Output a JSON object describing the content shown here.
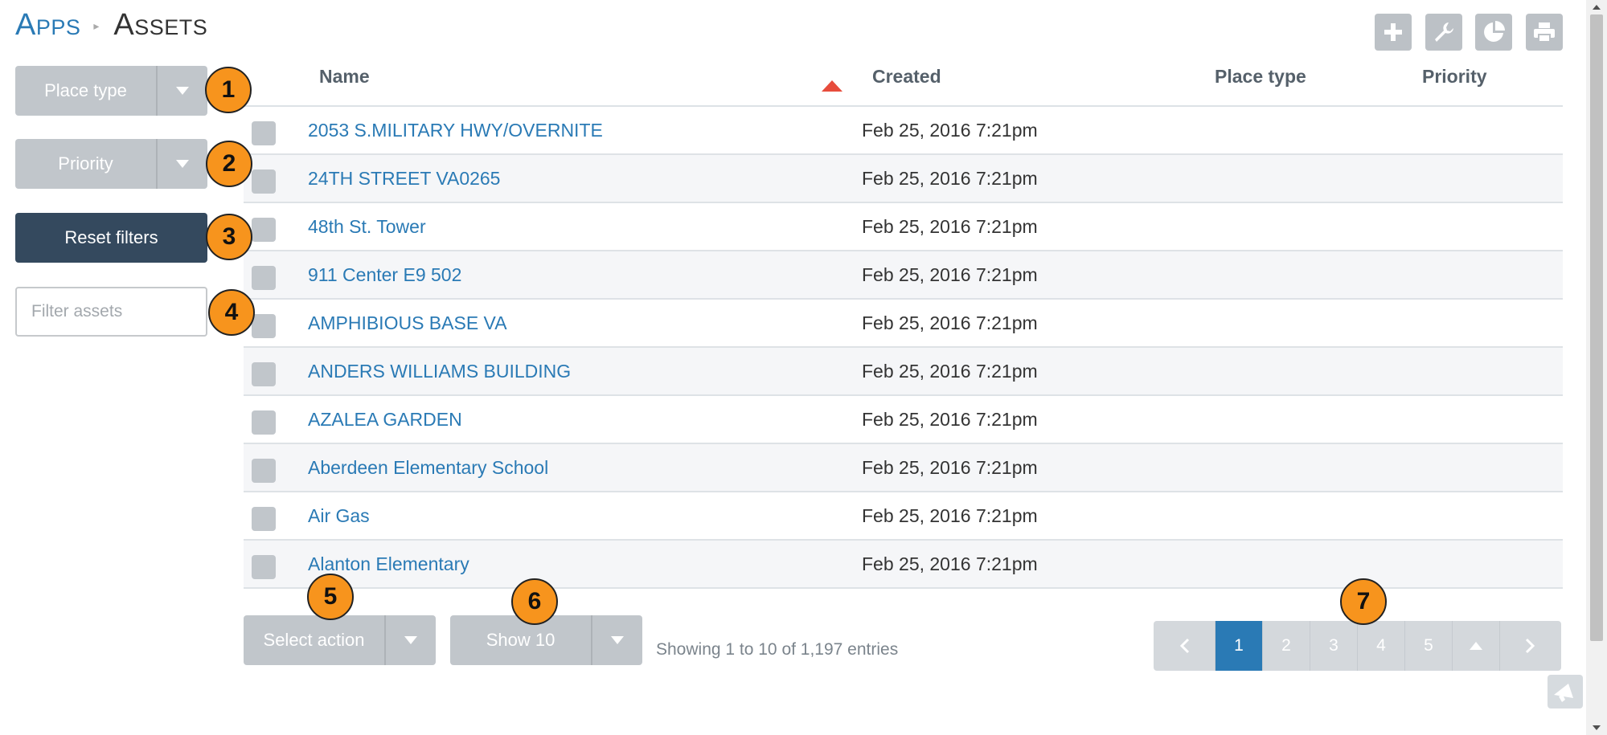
{
  "breadcrumb": {
    "root": "Apps",
    "current": "Assets"
  },
  "toolbar": {
    "buttons": [
      {
        "icon": "plus-icon"
      },
      {
        "icon": "wrench-icon"
      },
      {
        "icon": "pie-chart-icon"
      },
      {
        "icon": "print-icon"
      }
    ]
  },
  "filters": {
    "place_type_label": "Place type",
    "priority_label": "Priority",
    "reset_label": "Reset filters",
    "search_placeholder": "Filter assets"
  },
  "table": {
    "columns": [
      "Name",
      "Created",
      "Place type",
      "Priority"
    ],
    "sort_column": "Name",
    "sort_direction": "ascending",
    "rows": [
      {
        "name": "2053 S.MILITARY HWY/OVERNITE",
        "created": "Feb 25, 2016 7:21pm"
      },
      {
        "name": "24TH STREET VA0265",
        "created": "Feb 25, 2016 7:21pm"
      },
      {
        "name": "48th St. Tower",
        "created": "Feb 25, 2016 7:21pm"
      },
      {
        "name": "911 Center E9 502",
        "created": "Feb 25, 2016 7:21pm"
      },
      {
        "name": "AMPHIBIOUS BASE VA",
        "created": "Feb 25, 2016 7:21pm"
      },
      {
        "name": "ANDERS WILLIAMS BUILDING",
        "created": "Feb 25, 2016 7:21pm"
      },
      {
        "name": "AZALEA GARDEN",
        "created": "Feb 25, 2016 7:21pm"
      },
      {
        "name": "Aberdeen Elementary School",
        "created": "Feb 25, 2016 7:21pm"
      },
      {
        "name": "Air Gas",
        "created": "Feb 25, 2016 7:21pm"
      },
      {
        "name": "Alanton Elementary",
        "created": "Feb 25, 2016 7:21pm"
      }
    ]
  },
  "footer": {
    "select_action_label": "Select action",
    "show_label": "Show 10",
    "entries_text": "Showing 1 to 10 of 1,197 entries",
    "pages": [
      "1",
      "2",
      "3",
      "4",
      "5"
    ],
    "current_page": "1"
  },
  "markers": [
    "1",
    "2",
    "3",
    "4",
    "5",
    "6",
    "7"
  ],
  "colors": {
    "link": "#2a7ab5",
    "reset_button": "#34495e",
    "marker": "#f7941d",
    "sort_arrow": "#e74c3c"
  }
}
